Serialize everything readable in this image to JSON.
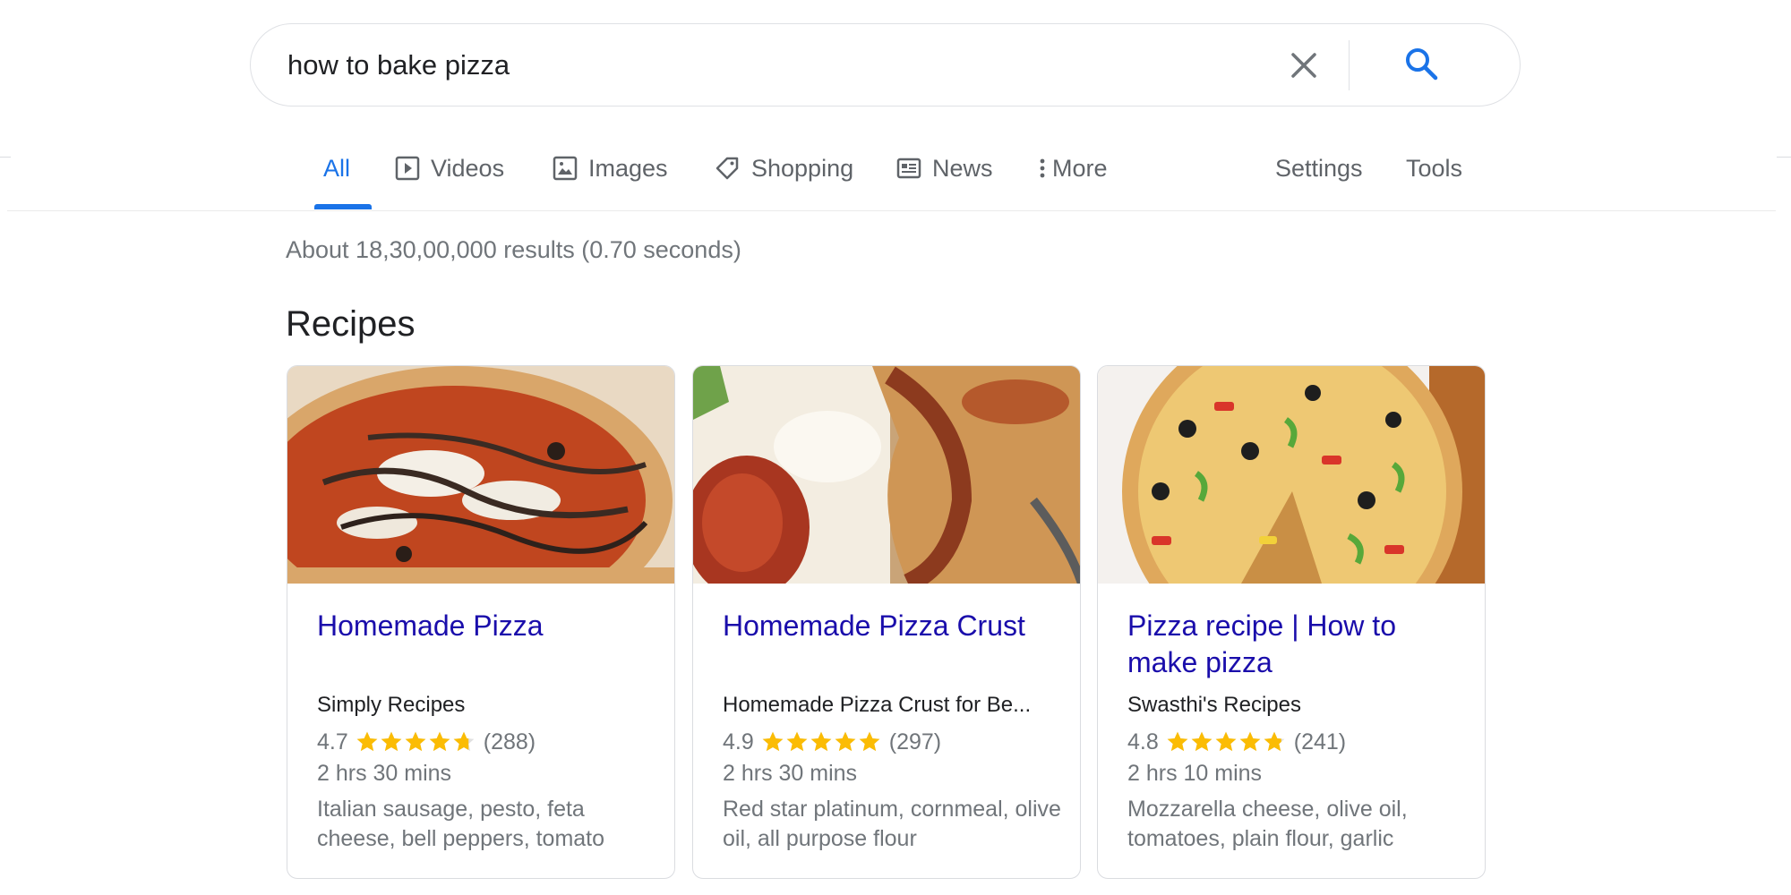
{
  "search": {
    "query": "how to bake pizza"
  },
  "tabs": [
    {
      "label": "All",
      "icon": "none",
      "active": true
    },
    {
      "label": "Videos",
      "icon": "play-icon"
    },
    {
      "label": "Images",
      "icon": "image-icon"
    },
    {
      "label": "Shopping",
      "icon": "tag-icon"
    },
    {
      "label": "News",
      "icon": "news-icon"
    },
    {
      "label": "More",
      "icon": "dots-vertical-icon"
    },
    {
      "label": "Settings"
    },
    {
      "label": "Tools"
    }
  ],
  "results_stats": "About 18,30,00,000 results (0.70 seconds)",
  "section_title": "Recipes",
  "colors": {
    "accent": "#1a73e8",
    "link": "#1a0dab",
    "star": "#fbbc04",
    "muted": "#70757a"
  },
  "recipes": [
    {
      "title": "Homemade Pizza",
      "source": "Simply Recipes",
      "rating": "4.7",
      "stars": 4.7,
      "reviews": "(288)",
      "time": "2 hrs 30 mins",
      "ingredients": "Italian sausage, pesto, feta cheese, bell peppers, tomato"
    },
    {
      "title": "Homemade Pizza Crust",
      "source": "Homemade Pizza Crust for Be...",
      "rating": "4.9",
      "stars": 4.9,
      "reviews": "(297)",
      "time": "2 hrs 30 mins",
      "ingredients": "Red star platinum, cornmeal, olive oil, all purpose flour"
    },
    {
      "title": "Pizza recipe | How to make pizza",
      "source": "Swasthi's Recipes",
      "rating": "4.8",
      "stars": 4.8,
      "reviews": "(241)",
      "time": "2 hrs 10 mins",
      "ingredients": "Mozzarella cheese, olive oil, tomatoes, plain flour, garlic"
    }
  ]
}
